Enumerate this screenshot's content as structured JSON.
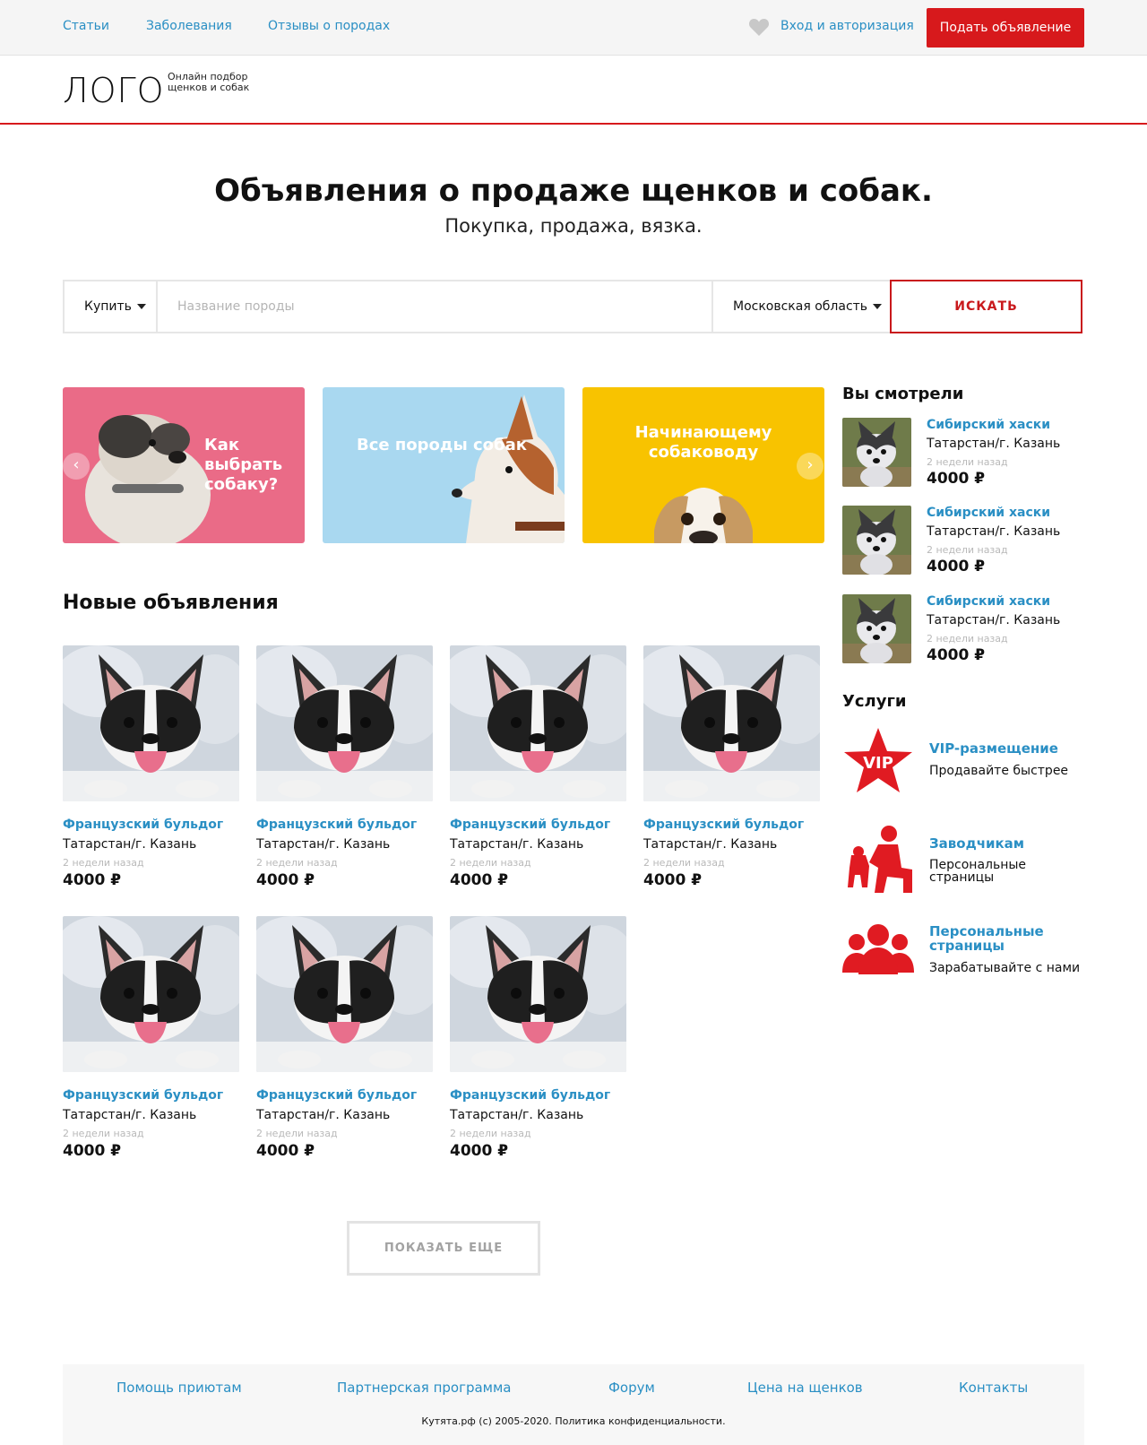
{
  "topbar": {
    "nav": [
      "Статьи",
      "Заболевания",
      "Отзывы о породах"
    ],
    "favorites_icon": "heart-icon",
    "login_label": "Вход и авторизация",
    "post_button": "Подать объявление"
  },
  "logo": {
    "text": "ЛОГО",
    "tagline": "Онлайн подбор щенков и собак"
  },
  "hero": {
    "title": "Объявления о продаже щенков и собак.",
    "subtitle": "Покупка, продажа, вязка."
  },
  "search": {
    "mode": "Купить",
    "breed_placeholder": "Название породы",
    "region": "Московская область",
    "button": "ИСКАТЬ"
  },
  "banners": [
    {
      "text": "Как выбрать собаку?",
      "color": "#ea6b87"
    },
    {
      "text": "Все породы собак",
      "color": "#a9d8f0"
    },
    {
      "text": "Начинающему собаководу",
      "color": "#f8c300"
    }
  ],
  "new_listings": {
    "title": "Новые объявления",
    "items": [
      {
        "breed": "Французский бульдог",
        "location": "Татарстан/г. Казань",
        "ago": "2 недели назад",
        "price": "4000 ₽"
      },
      {
        "breed": "Французский бульдог",
        "location": "Татарстан/г. Казань",
        "ago": "2 недели назад",
        "price": "4000 ₽"
      },
      {
        "breed": "Французский бульдог",
        "location": "Татарстан/г. Казань",
        "ago": "2 недели назад",
        "price": "4000 ₽"
      },
      {
        "breed": "Французский бульдог",
        "location": "Татарстан/г. Казань",
        "ago": "2 недели назад",
        "price": "4000 ₽"
      },
      {
        "breed": "Французский бульдог",
        "location": "Татарстан/г. Казань",
        "ago": "2 недели назад",
        "price": "4000 ₽"
      },
      {
        "breed": "Французский бульдог",
        "location": "Татарстан/г. Казань",
        "ago": "2 недели назад",
        "price": "4000 ₽"
      },
      {
        "breed": "Французский бульдог",
        "location": "Татарстан/г. Казань",
        "ago": "2 недели назад",
        "price": "4000 ₽"
      }
    ],
    "more_button": "ПОКАЗАТЬ ЕЩЕ"
  },
  "viewed": {
    "title": "Вы смотрели",
    "items": [
      {
        "breed": "Сибирский хаски",
        "location": "Татарстан/г. Казань",
        "ago": "2 недели назад",
        "price": "4000 ₽"
      },
      {
        "breed": "Сибирский хаски",
        "location": "Татарстан/г. Казань",
        "ago": "2 недели назад",
        "price": "4000 ₽"
      },
      {
        "breed": "Сибирский хаски",
        "location": "Татарстан/г. Казань",
        "ago": "2 недели назад",
        "price": "4000 ₽"
      }
    ]
  },
  "services": {
    "title": "Услуги",
    "items": [
      {
        "title": "VIP-размещение",
        "desc": "Продавайте быстрее",
        "icon": "vip-star-icon",
        "icon_text": "VIP"
      },
      {
        "title": "Заводчикам",
        "desc": "Персональные страницы",
        "icon": "breeder-with-dog-icon"
      },
      {
        "title": "Персональные страницы",
        "desc": "Зарабатывайте с нами",
        "icon": "group-people-icon"
      }
    ]
  },
  "footer": {
    "links": [
      "Помощь приютам",
      "Партнерская программа",
      "Форум",
      "Цена на щенков",
      "Контакты"
    ],
    "copyright": "Кутята.рф (с) 2005-2020. Политика конфиденциальности."
  },
  "colors": {
    "accent_red": "#d7191c",
    "link_blue": "#2a8fc4"
  }
}
